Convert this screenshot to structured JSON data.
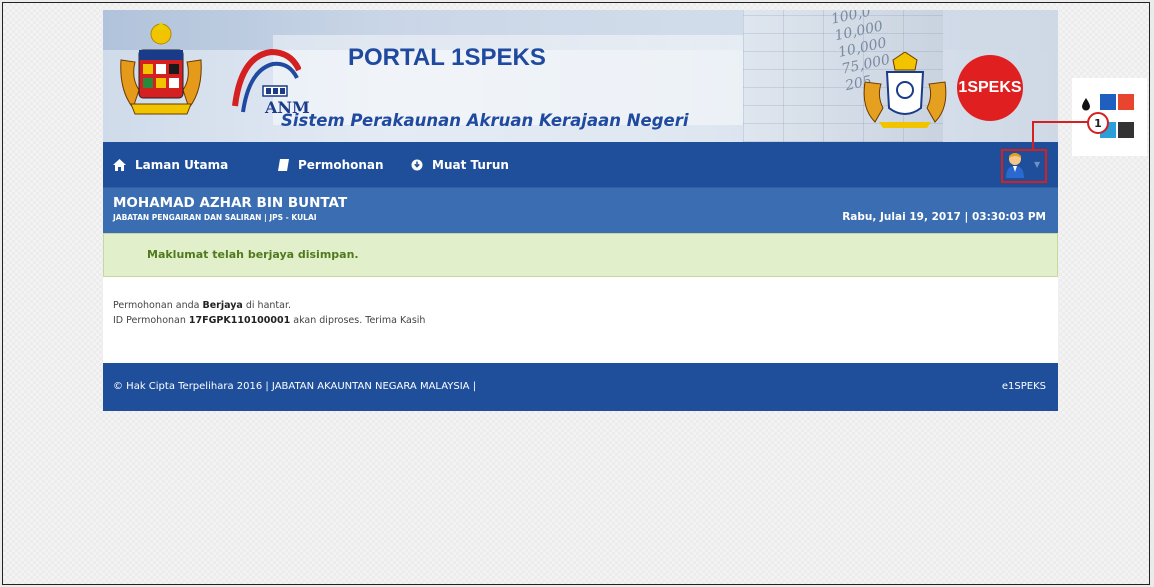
{
  "banner": {
    "title": "PORTAL 1SPEKS",
    "subtitle": "Sistem Perakaunan Akruan Kerajaan Negeri",
    "anm_label": "ANM",
    "badge_text": "1SPEKS",
    "bg_numbers": [
      "100,0",
      "10,000",
      "10,000",
      "75,000",
      "205"
    ]
  },
  "nav": {
    "items": [
      {
        "label": "Laman Utama",
        "icon": "home-icon"
      },
      {
        "label": "Permohonan",
        "icon": "book-icon"
      },
      {
        "label": "Muat Turun",
        "icon": "download-icon"
      }
    ],
    "user_icon": "user-icon"
  },
  "userbar": {
    "name": "MOHAMAD AZHAR BIN BUNTAT",
    "department": "JABATAN PENGAIRAN DAN SALIRAN | JPS - KULAI",
    "datetime": "Rabu, Julai 19, 2017 | 03:30:03 PM"
  },
  "alert": {
    "message": "Maklumat telah berjaya disimpan."
  },
  "content": {
    "line1_pre": "Permohonan anda ",
    "line1_bold": "Berjaya",
    "line1_post": " di hantar.",
    "line2_pre": "ID Permohonan ",
    "line2_bold": "17FGPK110100001",
    "line2_post": " akan diproses. Terima Kasih"
  },
  "footer": {
    "left": "© Hak Cipta Terpelihara 2016 | JABATAN AKAUNTAN NEGARA MALAYSIA |",
    "right": "e1SPEKS"
  },
  "widget": {
    "swatches": [
      "#1f5fbf",
      "#e8442e",
      "#2a9fd8",
      "#333333"
    ]
  },
  "callout": {
    "number": "1",
    "color": "#d42020"
  },
  "colors": {
    "nav_bg": "#1f4f9a",
    "userbar_bg": "#3a6db1",
    "alert_bg": "#e2efcb",
    "alert_text": "#4f7a1d"
  }
}
